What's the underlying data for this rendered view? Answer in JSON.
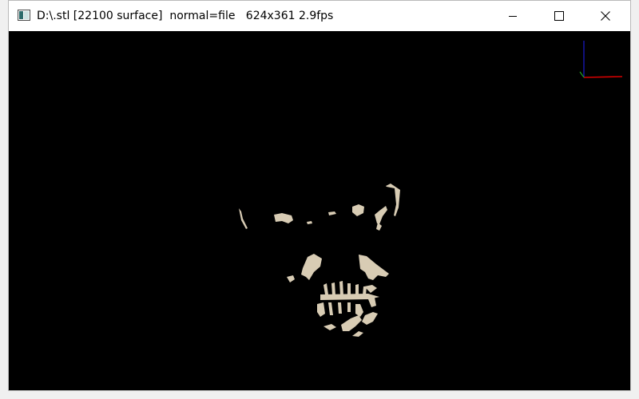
{
  "window": {
    "title": "D:\\.stl [22100 surface]  normal=file   624x361 2.9fps",
    "icon": "app-window-icon"
  },
  "caption_buttons": {
    "minimize": "minimize-icon",
    "maximize": "maximize-icon",
    "close": "close-icon"
  },
  "viewport": {
    "background": "#000000",
    "model_color": "#d8ccb4",
    "axes": {
      "x_color": "#d40000",
      "y_color": "#1a1ad0",
      "z_color": "#20a020"
    }
  }
}
